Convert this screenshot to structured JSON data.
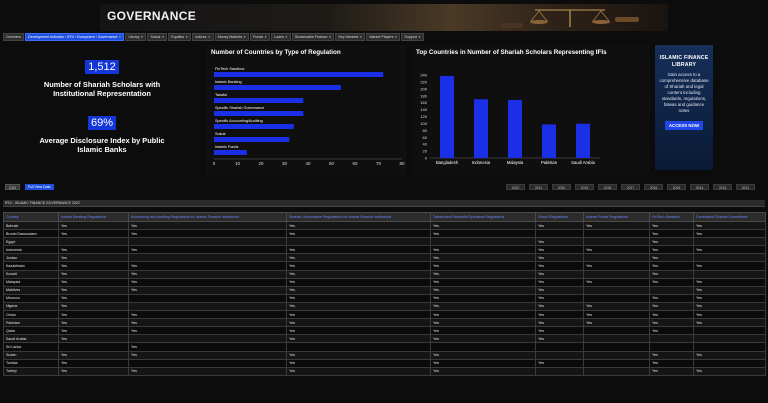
{
  "banner": {
    "title": "GOVERNANCE"
  },
  "nav": [
    {
      "label": "Overview",
      "active": false
    },
    {
      "label": "Development Indicator › IFDI › Ecosystem › Governance",
      "active": true
    },
    {
      "label": "Library",
      "active": false
    },
    {
      "label": "Sukuk",
      "active": false
    },
    {
      "label": "Equities",
      "active": false
    },
    {
      "label": "Indices",
      "active": false
    },
    {
      "label": "Money Markets",
      "active": false
    },
    {
      "label": "Funds",
      "active": false
    },
    {
      "label": "Loans",
      "active": false
    },
    {
      "label": "Sustainable Finance",
      "active": false
    },
    {
      "label": "Key Markets",
      "active": false
    },
    {
      "label": "Market Players",
      "active": false
    },
    {
      "label": "Support",
      "active": false
    }
  ],
  "kpis": [
    {
      "value": "1,512",
      "label": "Number of Shariah Scholars with Institutional Representation"
    },
    {
      "value": "69%",
      "label": "Average Disclosure Index by Public Islamic Banks"
    }
  ],
  "chart_regulation": {
    "chart_data": {
      "type": "bar",
      "orientation": "horizontal",
      "title": "Number of Countries by Type of Regulation",
      "categories": [
        "FinTech Sandbox",
        "Islamic Banking",
        "Takaful",
        "Specific Shariah Governance",
        "Specific Accounting/Auditing",
        "Sukuk",
        "Islamic Funds"
      ],
      "values": [
        72,
        54,
        38,
        38,
        34,
        32,
        14
      ],
      "xlim": [
        0,
        80
      ],
      "xticks": [
        0,
        10,
        20,
        30,
        40,
        50,
        60,
        70,
        80
      ],
      "color": "#1a2fe6"
    }
  },
  "chart_scholars": {
    "chart_data": {
      "type": "bar",
      "title": "Top Countries in Number of Shariah Scholars Representing IFIs",
      "categories": [
        "Bangladesh",
        "Indonesia",
        "Malaysia",
        "Pakistan",
        "Saudi Arabia"
      ],
      "values": [
        237,
        170,
        168,
        97,
        99
      ],
      "ylim": [
        0,
        240
      ],
      "yticks": [
        0,
        20,
        40,
        60,
        80,
        100,
        120,
        140,
        160,
        180,
        200,
        220,
        240
      ],
      "color": "#1a2fe6"
    }
  },
  "ad": {
    "title": "ISLAMIC FINANCE LIBRARY",
    "body": "Gain access to a comprehensive database of Shariah and legal content including standards, regulations, fatwas and guidance notes",
    "button": "ACCESS NOW"
  },
  "controls": {
    "left_button": "CSV",
    "right_button": "Full View Data",
    "years": [
      "2022",
      "2021",
      "2020",
      "2019",
      "2018",
      "2017",
      "2016",
      "2015",
      "2014",
      "2013",
      "2012"
    ]
  },
  "table": {
    "title": "IFDI - ISLAMIC FINANCE GOVERNANCE 2022",
    "columns": [
      "Country",
      "Islamic Banking Regulations",
      "Accounting and Auditing Regulations for Islamic Finance Institutions",
      "Shariah Governance Regulations for Islamic Finance Institutions",
      "Takaful and Retakaful Operation Regulations",
      "Sukuk Regulations",
      "Islamic Funds Regulations",
      "FinTech Sandbox",
      "Centralised Shariah Committees"
    ],
    "rows": [
      [
        "Bahrain",
        "Yes",
        "Yes",
        "Yes",
        "Yes",
        "Yes",
        "Yes",
        "Yes",
        "Yes"
      ],
      [
        "Brunei Darussalam",
        "Yes",
        "Yes",
        "Yes",
        "Yes",
        "",
        "",
        "Yes",
        "Yes"
      ],
      [
        "Egypt",
        "",
        "",
        "",
        "",
        "Yes",
        "",
        "Yes",
        ""
      ],
      [
        "Indonesia",
        "Yes",
        "Yes",
        "Yes",
        "Yes",
        "Yes",
        "Yes",
        "Yes",
        "Yes"
      ],
      [
        "Jordan",
        "Yes",
        "",
        "Yes",
        "Yes",
        "Yes",
        "",
        "Yes",
        ""
      ],
      [
        "Kazakhstan",
        "Yes",
        "Yes",
        "Yes",
        "Yes",
        "Yes",
        "Yes",
        "Yes",
        "Yes"
      ],
      [
        "Kuwait",
        "Yes",
        "Yes",
        "Yes",
        "Yes",
        "Yes",
        "",
        "Yes",
        ""
      ],
      [
        "Malaysia",
        "Yes",
        "Yes",
        "Yes",
        "Yes",
        "Yes",
        "Yes",
        "Yes",
        "Yes"
      ],
      [
        "Maldives",
        "Yes",
        "Yes",
        "Yes",
        "Yes",
        "Yes",
        "",
        "",
        "Yes"
      ],
      [
        "Morocco",
        "Yes",
        "",
        "Yes",
        "Yes",
        "Yes",
        "",
        "Yes",
        "Yes"
      ],
      [
        "Nigeria",
        "Yes",
        "",
        "Yes",
        "Yes",
        "Yes",
        "Yes",
        "Yes",
        "Yes"
      ],
      [
        "Oman",
        "Yes",
        "Yes",
        "Yes",
        "Yes",
        "Yes",
        "Yes",
        "Yes",
        "Yes"
      ],
      [
        "Pakistan",
        "Yes",
        "Yes",
        "Yes",
        "Yes",
        "Yes",
        "Yes",
        "Yes",
        "Yes"
      ],
      [
        "Qatar",
        "Yes",
        "Yes",
        "Yes",
        "Yes",
        "Yes",
        "",
        "Yes",
        ""
      ],
      [
        "Saudi Arabia",
        "Yes",
        "",
        "Yes",
        "Yes",
        "Yes",
        "",
        "",
        ""
      ],
      [
        "Sri Lanka",
        "",
        "Yes",
        "",
        "",
        "",
        "",
        "",
        ""
      ],
      [
        "Sudan",
        "Yes",
        "Yes",
        "Yes",
        "Yes",
        "",
        "",
        "Yes",
        "Yes"
      ],
      [
        "Tunisia",
        "Yes",
        "",
        "Yes",
        "Yes",
        "Yes",
        "",
        "Yes",
        ""
      ],
      [
        "Turkey",
        "Yes",
        "Yes",
        "Yes",
        "Yes",
        "",
        "",
        "Yes",
        "Yes"
      ]
    ]
  }
}
